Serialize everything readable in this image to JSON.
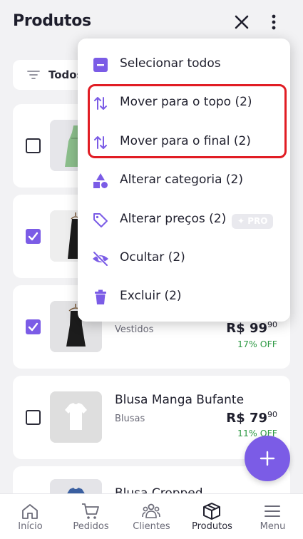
{
  "app_bar": {
    "title": "Produtos"
  },
  "filter": {
    "label": "Todos"
  },
  "products": [
    {
      "name": "",
      "category": "",
      "price_main": "",
      "price_cents": "",
      "discount": "",
      "checked": false,
      "colors": {
        "garment": "#8cbf8c"
      }
    },
    {
      "name": "",
      "category": "",
      "price_main": "",
      "price_cents": "",
      "discount": "",
      "checked": true,
      "colors": {
        "garment": "#1c1c1c"
      }
    },
    {
      "name": "",
      "category": "Vestidos",
      "price_main": "R$ 99",
      "price_cents": "90",
      "discount": "17% OFF",
      "checked": true,
      "colors": {
        "garment": "#1c1c1c"
      }
    },
    {
      "name": "Blusa Manga Bufante",
      "category": "Blusas",
      "price_main": "R$ 79",
      "price_cents": "90",
      "discount": "11% OFF",
      "checked": false,
      "colors": {
        "garment": "#ffffff"
      }
    },
    {
      "name": "Blusa Cropped ...",
      "category": "",
      "price_main": "",
      "price_cents": "",
      "discount": "",
      "checked": false,
      "colors": {
        "garment": "#3a5fa0"
      }
    }
  ],
  "menu": {
    "items": [
      {
        "label": "Selecionar todos",
        "icon": "minus-square-icon"
      },
      {
        "label": "Mover para o topo (2)",
        "icon": "sort-arrows-icon"
      },
      {
        "label": "Mover para o final (2)",
        "icon": "sort-arrows-icon"
      },
      {
        "label": "Alterar categoria (2)",
        "icon": "shapes-icon"
      },
      {
        "label": "Alterar preços (2)",
        "icon": "tag-icon",
        "badge": "PRO"
      },
      {
        "label": "Ocultar (2)",
        "icon": "eye-off-icon"
      },
      {
        "label": "Excluir (2)",
        "icon": "trash-icon"
      }
    ]
  },
  "bottom_nav": [
    {
      "label": "Início",
      "icon": "home-icon",
      "active": false
    },
    {
      "label": "Pedidos",
      "icon": "cart-icon",
      "active": false
    },
    {
      "label": "Clientes",
      "icon": "users-icon",
      "active": false
    },
    {
      "label": "Produtos",
      "icon": "box-icon",
      "active": true
    },
    {
      "label": "Menu",
      "icon": "menu-icon",
      "active": false
    }
  ],
  "colors": {
    "accent": "#7b5ce6",
    "discount": "#2f9a45",
    "highlight": "#e11d24"
  }
}
